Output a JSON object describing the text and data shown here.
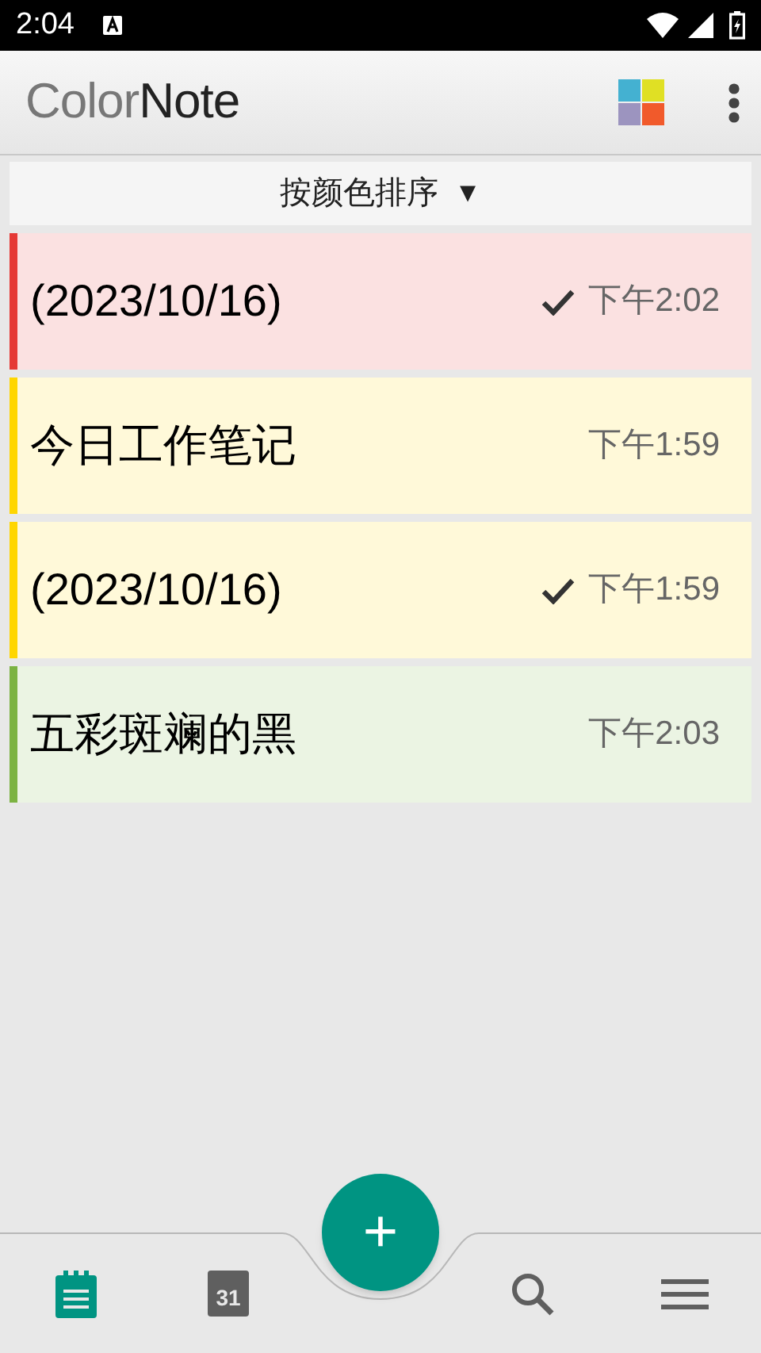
{
  "status_bar": {
    "time": "2:04"
  },
  "app_bar": {
    "logo_parts": [
      "Color",
      "Note"
    ]
  },
  "sort_bar": {
    "label": "按颜色排序",
    "arrow": "▼"
  },
  "notes": [
    {
      "title": "(2023/10/16)",
      "time": "下午2:02",
      "checked": true,
      "color": "#e53935"
    },
    {
      "title": "今日工作笔记",
      "time": "下午1:59",
      "checked": false,
      "color": "#ffd600"
    },
    {
      "title": "(2023/10/16)",
      "time": "下午1:59",
      "checked": true,
      "color": "#ffd600"
    },
    {
      "title": "五彩斑斓的黑",
      "time": "下午2:03",
      "checked": false,
      "color": "#7cb342"
    }
  ],
  "fab": {
    "label": "+"
  },
  "bottom_nav": [
    {
      "kind": "notes",
      "selected": true
    },
    {
      "kind": "calendar",
      "label": "31",
      "selected": false
    },
    {
      "kind": "search",
      "selected": false
    },
    {
      "kind": "menu",
      "selected": false
    }
  ]
}
